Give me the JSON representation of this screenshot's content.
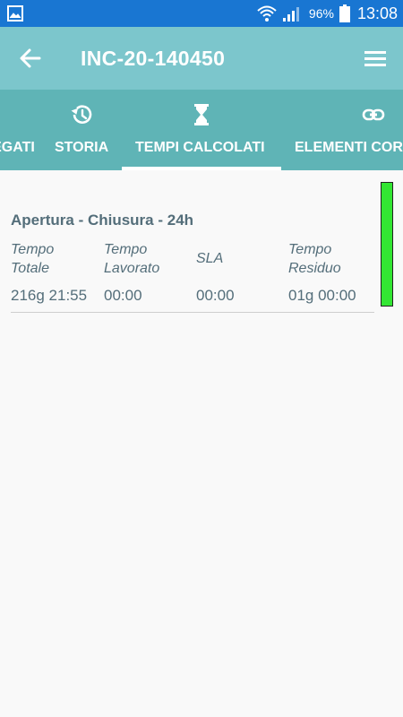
{
  "statusbar": {
    "battery_percent": "96%",
    "time": "13:08"
  },
  "toolbar": {
    "title": "INC-20-140450"
  },
  "tabs": [
    {
      "label": "ALLEGATI",
      "icon": "attachment-icon"
    },
    {
      "label": "STORIA",
      "icon": "history-icon"
    },
    {
      "label": "TEMPI CALCOLATI",
      "icon": "hourglass-icon",
      "active": true
    },
    {
      "label": "ELEMENTI CORRELATI",
      "icon": "link-icon"
    }
  ],
  "card": {
    "title": "Apertura - Chiusura - 24h",
    "columns": [
      {
        "header_line1": "Tempo",
        "header_line2": "Totale",
        "value": "216g 21:55"
      },
      {
        "header_line1": "Tempo",
        "header_line2": "Lavorato",
        "value": "00:00"
      },
      {
        "header_line1": "SLA",
        "header_line2": "",
        "value": "00:00"
      },
      {
        "header_line1": "Tempo",
        "header_line2": "Residuo",
        "value": "01g 00:00"
      }
    ],
    "sla_status_color": "#33e633"
  },
  "colors": {
    "statusbar": "#1976d2",
    "toolbar": "#7cc6cc",
    "tabbar": "#5fb4b6",
    "text": "#546e7a"
  }
}
